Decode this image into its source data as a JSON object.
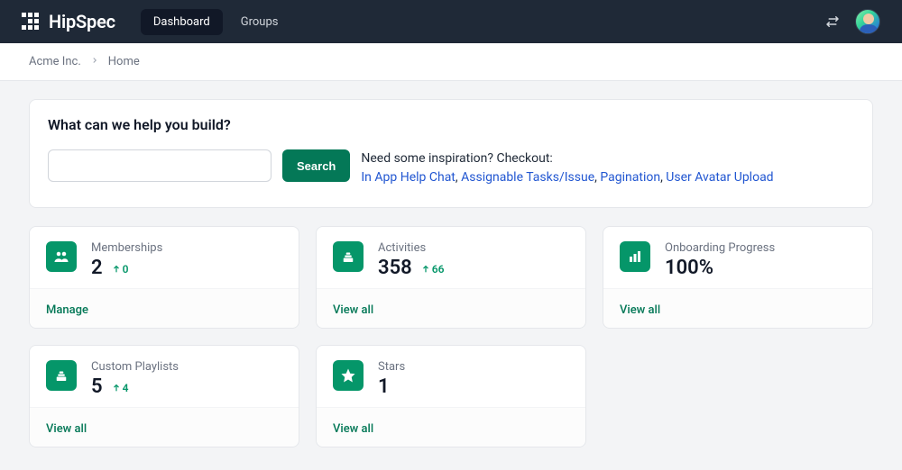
{
  "brand": {
    "name": "HipSpec"
  },
  "nav": {
    "tabs": [
      {
        "label": "Dashboard",
        "active": true
      },
      {
        "label": "Groups",
        "active": false
      }
    ]
  },
  "breadcrumb": {
    "items": [
      "Acme Inc.",
      "Home"
    ]
  },
  "hero": {
    "title": "What can we help you build?",
    "search_button": "Search",
    "inspiration_prompt": "Need some inspiration? Checkout:",
    "links": [
      "In App Help Chat",
      "Assignable Tasks/Issue",
      "Pagination",
      "User Avatar Upload"
    ]
  },
  "cards": [
    {
      "icon": "users-icon",
      "title": "Memberships",
      "value": "2",
      "delta": "0",
      "footer": "Manage"
    },
    {
      "icon": "stack-icon",
      "title": "Activities",
      "value": "358",
      "delta": "66",
      "footer": "View all"
    },
    {
      "icon": "bars-icon",
      "title": "Onboarding Progress",
      "value": "100%",
      "delta": null,
      "footer": "View all"
    },
    {
      "icon": "stack-icon",
      "title": "Custom Playlists",
      "value": "5",
      "delta": "4",
      "footer": "View all"
    },
    {
      "icon": "star-icon",
      "title": "Stars",
      "value": "1",
      "delta": null,
      "footer": "View all"
    }
  ],
  "colors": {
    "accent": "#059669",
    "link": "#2156d1",
    "navbar": "#1f2937"
  }
}
